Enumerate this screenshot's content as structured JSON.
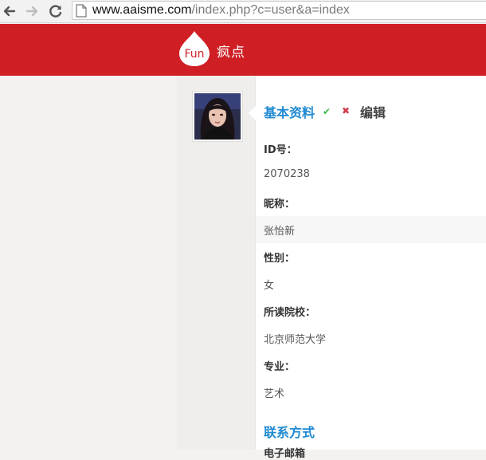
{
  "browser": {
    "url_domain": "www.aaisme.com",
    "url_path": "/index.php?c=user&a=index"
  },
  "header": {
    "brand": "疯点",
    "logo_text": "Fun",
    "bg_color": "#cf1f25"
  },
  "profile": {
    "tabs": {
      "basic": "基本资料",
      "check_icon": "✔",
      "cross_icon": "✖",
      "edit": "编辑"
    },
    "fields": [
      {
        "label": "ID号：",
        "value": "2070238"
      },
      {
        "label": "昵称：",
        "value": "张怡新"
      },
      {
        "label": "性别：",
        "value": "女"
      },
      {
        "label": "所读院校：",
        "value": "北京师范大学"
      },
      {
        "label": "专业：",
        "value": "艺术"
      }
    ],
    "contact_title": "联系方式",
    "contact_first_label_partial": "电子邮箱"
  },
  "colors": {
    "accent": "#1f8ad2",
    "check": "#3fba4a",
    "cross": "#d23a4a"
  }
}
